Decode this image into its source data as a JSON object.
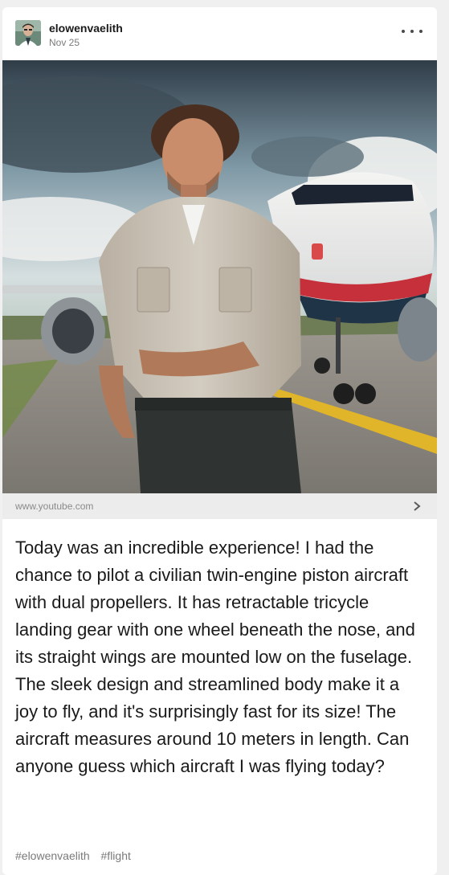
{
  "post": {
    "username": "elowenvaelith",
    "date": "Nov 25",
    "menu_icon": "more-horizontal-icon",
    "image_description_icon": "post-photo",
    "link": {
      "url": "www.youtube.com",
      "icon": "chevron-right-icon"
    },
    "text": "Today was an incredible experience! I had the chance to pilot a civilian twin-engine piston aircraft with dual propellers. It has retractable tricycle landing gear with one wheel beneath the nose, and its straight wings are mounted low on the fuselage. The sleek design and streamlined body make it a joy to fly, and it's surprisingly fast for its size! The aircraft measures around 10 meters in length. Can anyone guess which aircraft I was flying today?",
    "tags": [
      "#elowenvaelith",
      "#flight"
    ]
  },
  "colors": {
    "background": "#f0f0f0",
    "card": "#ffffff",
    "link_bar": "#ececec",
    "text": "#1a1a1a",
    "muted": "#7a7a7a"
  }
}
